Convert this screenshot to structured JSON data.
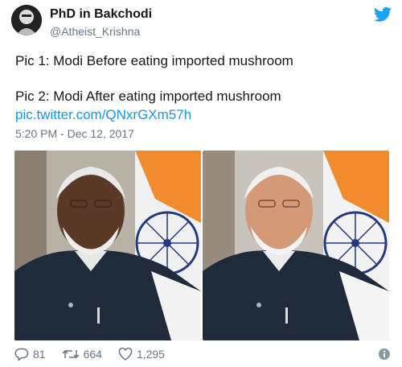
{
  "author": {
    "name": "PhD in Bakchodi",
    "handle": "@Atheist_Krishna"
  },
  "tweet": {
    "line1": "Pic 1: Modi Before eating imported mushroom",
    "line2": "Pic 2: Modi After eating imported mushroom",
    "link": "pic.twitter.com/QNxrGXm57h",
    "timestamp": "5:20 PM - Dec 12, 2017"
  },
  "actions": {
    "replies": "81",
    "retweets": "664",
    "likes": "1,295"
  },
  "colors": {
    "brand": "#1da1f2",
    "link": "#1b95e0",
    "muted": "#657786",
    "text": "#14171a"
  },
  "icons": [
    "twitter-bird-icon",
    "reply-icon",
    "retweet-icon",
    "like-icon",
    "info-icon"
  ]
}
